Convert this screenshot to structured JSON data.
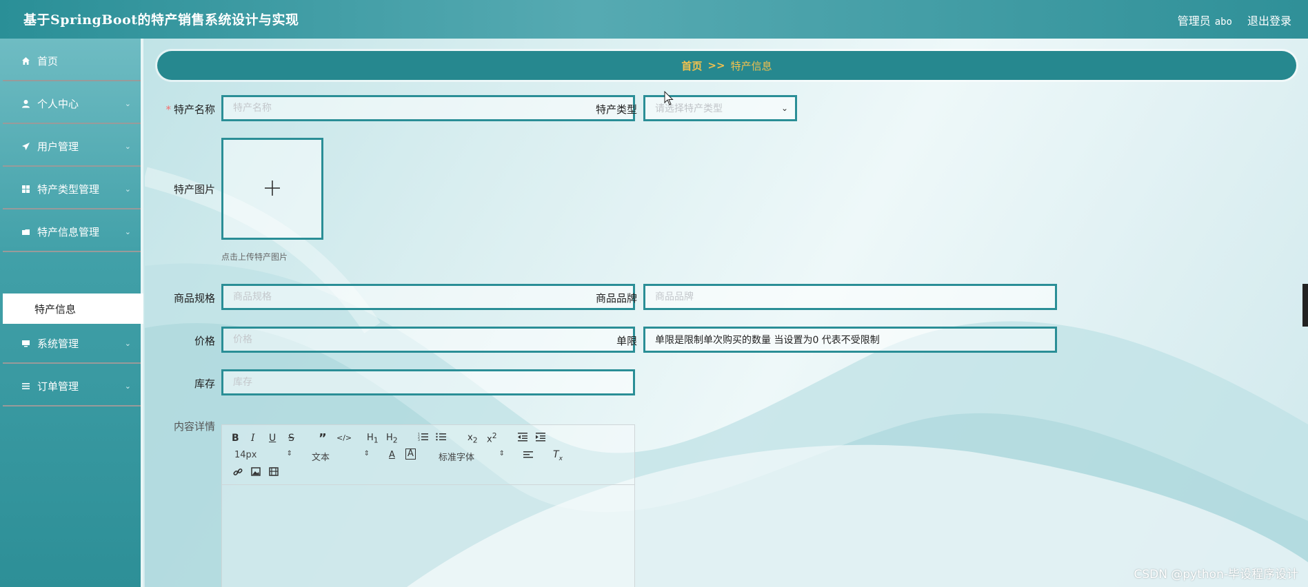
{
  "header": {
    "title": "基于SpringBoot的特产销售系统设计与实现",
    "user_role": "管理员",
    "user_name": "abo",
    "logout": "退出登录"
  },
  "sidebar": {
    "items": [
      {
        "label": "首页",
        "icon": "home-icon"
      },
      {
        "label": "个人中心",
        "icon": "user-icon"
      },
      {
        "label": "用户管理",
        "icon": "send-icon"
      },
      {
        "label": "特产类型管理",
        "icon": "grid-icon"
      },
      {
        "label": "特产信息管理",
        "icon": "folder-icon"
      },
      {
        "label": "系统管理",
        "icon": "monitor-icon"
      },
      {
        "label": "订单管理",
        "icon": "list-icon"
      }
    ],
    "active_sub": "特产信息"
  },
  "breadcrumb": {
    "home": "首页",
    "separator": ">>",
    "current": "特产信息"
  },
  "form": {
    "name": {
      "label": "特产名称",
      "placeholder": "特产名称",
      "required": true
    },
    "type": {
      "label": "特产类型",
      "placeholder": "请选择特产类型"
    },
    "image": {
      "label": "特产图片",
      "hint": "点击上传特产图片"
    },
    "spec": {
      "label": "商品规格",
      "placeholder": "商品规格"
    },
    "brand": {
      "label": "商品品牌",
      "placeholder": "商品品牌"
    },
    "price": {
      "label": "价格",
      "placeholder": "价格"
    },
    "limit": {
      "label": "单限",
      "value": "单限是限制单次购买的数量 当设置为0 代表不受限制"
    },
    "stock": {
      "label": "库存",
      "placeholder": "库存"
    },
    "content": {
      "label": "内容详情"
    }
  },
  "editor": {
    "font_size": "14px",
    "block": "文本",
    "font": "标准字体"
  },
  "watermark": "CSDN @python-毕设程序设计",
  "colors": {
    "accent": "#2a8e96",
    "breadcrumb_text": "#f2c14e",
    "header": "#2a8f97"
  }
}
